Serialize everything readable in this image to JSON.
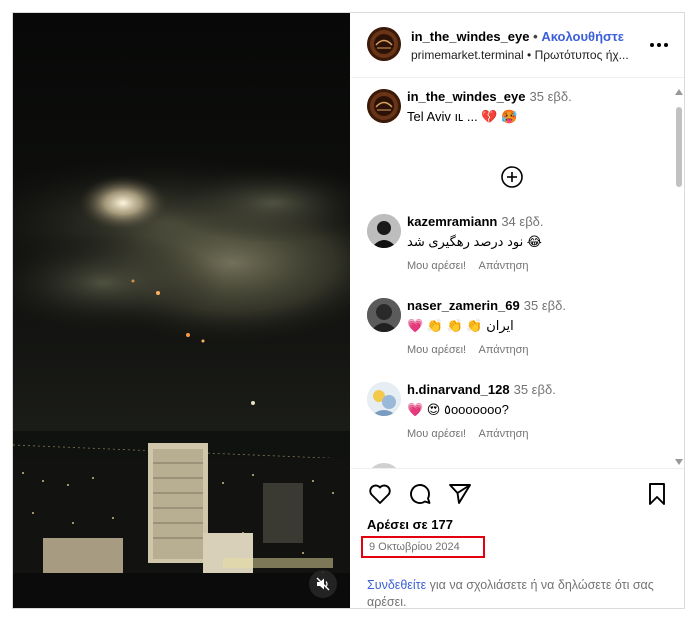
{
  "header": {
    "username": "in_the_windes_eye",
    "separator": "•",
    "follow_label": "Ακολουθήστε",
    "subtitle": "primemarket.terminal • Πρωτότυπος ήχ...",
    "more_icon": "more-horizontal-icon"
  },
  "caption": {
    "username": "in_the_windes_eye",
    "time": "35 εβδ.",
    "text": "Tel Aviv ıʟ ... 💔 🥵"
  },
  "comments": [
    {
      "username": "kazemramiann",
      "time": "34 εβδ.",
      "text": "نود درصد رهگیری شد 😂",
      "like_label": "Μου αρέσει!",
      "reply_label": "Απάντηση"
    },
    {
      "username": "naser_zamerin_69",
      "time": "35 εβδ.",
      "text": "💗 👏 👏 👏 ایران",
      "like_label": "Μου αρέσει!",
      "reply_label": "Απάντηση"
    },
    {
      "username": "h.dinarvand_128",
      "time": "35 εβδ.",
      "text": "💗 😍 ٥ooooooo?",
      "like_label": "Μου αρέσει!",
      "reply_label": "Απάντηση"
    }
  ],
  "footer": {
    "likes": "Αρέσει σε 177",
    "date": "9 Οκτωβρίου 2024",
    "login_link": "Συνδεθείτε",
    "login_text": " για να σχολιάσετε ή να δηλώσετε ότι σας αρέσει."
  },
  "colors": {
    "accent": "#3b5fd9",
    "highlight_box": "#e3000f",
    "muted_text": "#737373"
  }
}
